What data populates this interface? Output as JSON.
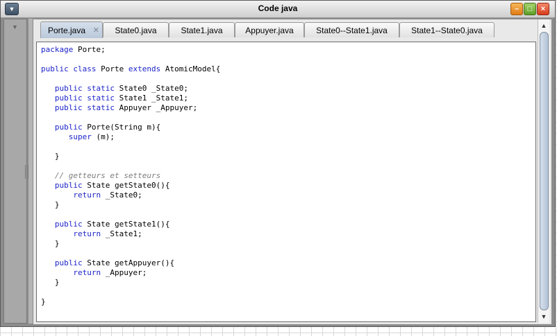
{
  "window": {
    "title": "Code java",
    "menu_icon": "dropdown-triangle-icon",
    "buttons": [
      "minimize",
      "maximize",
      "close"
    ]
  },
  "tabs": [
    {
      "label": "Porte.java",
      "active": true
    },
    {
      "label": "State0.java"
    },
    {
      "label": "State1.java"
    },
    {
      "label": "Appuyer.java"
    },
    {
      "label": "State0--State1.java"
    },
    {
      "label": "State1--State0.java"
    }
  ],
  "code": {
    "lines": [
      "package Porte;",
      "",
      "public class Porte extends AtomicModel{",
      "",
      "   public static State0 _State0;",
      "   public static State1 _State1;",
      "   public static Appuyer _Appuyer;",
      "",
      "   public Porte(String m){",
      "      super (m);",
      "",
      "   }",
      "",
      "   // getteurs et setteurs",
      "   public State getState0(){",
      "       return _State0;",
      "   }",
      "",
      "   public State getState1(){",
      "       return _State1;",
      "   }",
      "",
      "   public State getAppuyer(){",
      "       return _Appuyer;",
      "   }",
      "",
      "}"
    ]
  },
  "colors": {
    "keyword": "#1c23c8",
    "comment": "#7d7d7d"
  }
}
